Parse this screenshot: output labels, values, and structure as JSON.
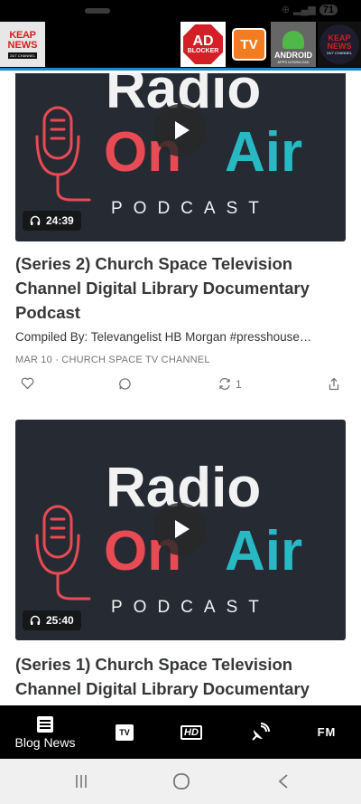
{
  "status_bar": {
    "battery": "71"
  },
  "ad_bar": {
    "keap_logo": {
      "line1": "KEAP",
      "line2": "NEWS",
      "tagline": "24/7 CHANNEL"
    },
    "apps": [
      {
        "name": "ad-blocker",
        "line1": "AD",
        "line2": "BLOCKER"
      },
      {
        "name": "tv",
        "label": "TV"
      },
      {
        "name": "android",
        "line1": "ANDROID",
        "line2": "APPS DOWNLOAD"
      },
      {
        "name": "keap-news",
        "line1": "KEAP",
        "line2": "NEWS",
        "line3": "24/7 CHANNEL"
      }
    ]
  },
  "thumbnail_text": {
    "line1": "Radio",
    "line2a": "On",
    "line2b": "Air",
    "line3": "PODCAST"
  },
  "posts": [
    {
      "duration": "24:39",
      "title_lines": [
        "(Series 2) Church Space Television",
        "Channel Digital Library Documentary",
        "Podcast"
      ],
      "subtitle": "Compiled By: Televangelist HB Morgan #presshouse…",
      "meta": "MAR 10 · CHURCH SPACE TV CHANNEL",
      "restacks": "1"
    },
    {
      "duration": "25:40",
      "title_lines": [
        "(Series 1) Church Space Television",
        "Channel Digital Library Documentary"
      ]
    }
  ],
  "bottom_nav": {
    "blog_news": "Blog News",
    "tv": "TV",
    "hd": "HD",
    "fm": "FM"
  },
  "colors": {
    "thumb_bg": "#262a33",
    "radio_red": "#e94b54",
    "air_teal": "#27b9c4",
    "header_accent": "#1e88c8"
  }
}
